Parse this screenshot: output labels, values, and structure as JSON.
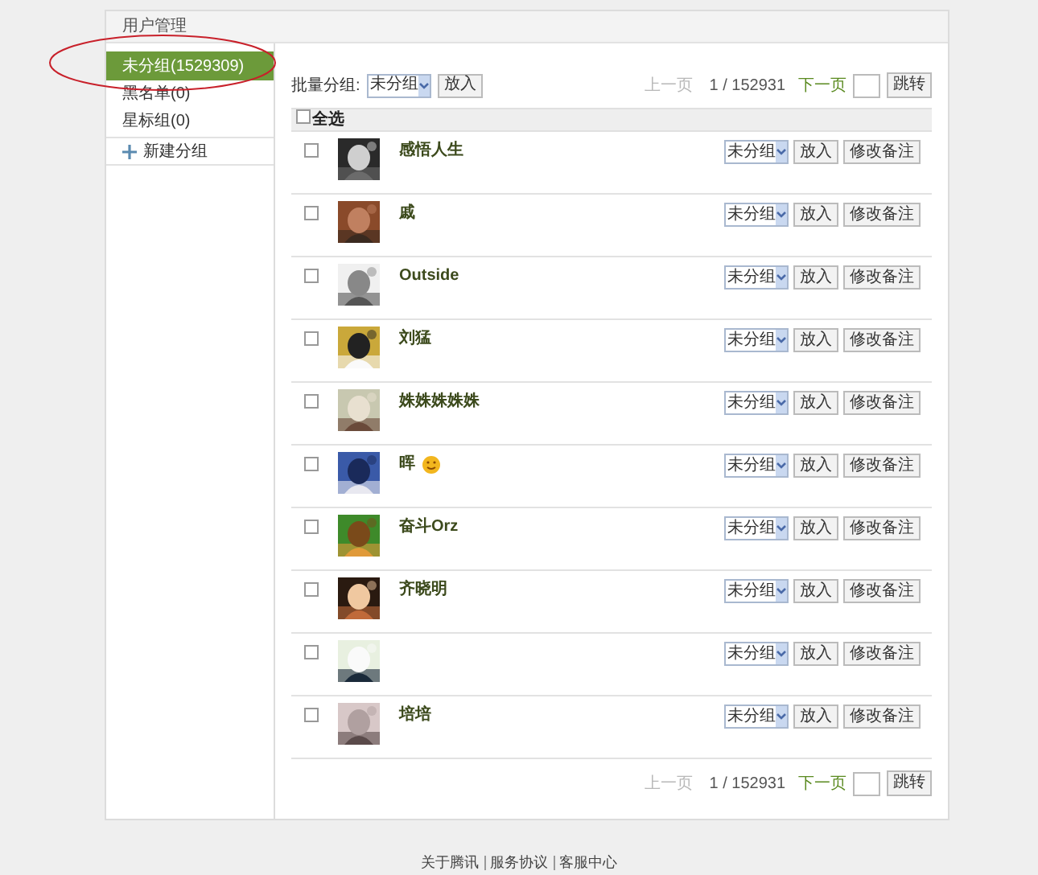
{
  "panel_title": "用户管理",
  "sidebar": {
    "items": [
      {
        "label": "未分组(1529309)",
        "selected": true
      },
      {
        "label": "黑名单(0)",
        "selected": false
      },
      {
        "label": "星标组(0)",
        "selected": false
      }
    ],
    "new_group": "新建分组"
  },
  "batch": {
    "label": "批量分组:",
    "select_value": "未分组",
    "button": "放入"
  },
  "pagers": [
    {
      "prev": "上一页",
      "prev_disabled": true,
      "page": "1 / 152931",
      "next": "下一页",
      "go": "跳转"
    },
    {
      "prev": "上一页",
      "prev_disabled": true,
      "page": "1 / 152931",
      "next": "下一页",
      "go": "跳转"
    }
  ],
  "select_all": {
    "label": "全选",
    "checked": false
  },
  "rows": [
    {
      "name": "感悟人生",
      "checked": false,
      "emoticon": false,
      "group": "未分组",
      "move": "放入",
      "remark": "修改备注"
    },
    {
      "name": "戚",
      "checked": false,
      "emoticon": false,
      "group": "未分组",
      "move": "放入",
      "remark": "修改备注"
    },
    {
      "name": "Outside",
      "checked": false,
      "emoticon": false,
      "group": "未分组",
      "move": "放入",
      "remark": "修改备注"
    },
    {
      "name": "刘猛",
      "checked": false,
      "emoticon": false,
      "group": "未分组",
      "move": "放入",
      "remark": "修改备注"
    },
    {
      "name": "姝姝姝姝姝",
      "checked": false,
      "emoticon": false,
      "group": "未分组",
      "move": "放入",
      "remark": "修改备注"
    },
    {
      "name": "晖",
      "checked": false,
      "emoticon": true,
      "group": "未分组",
      "move": "放入",
      "remark": "修改备注"
    },
    {
      "name": "奋斗Orz",
      "checked": false,
      "emoticon": false,
      "group": "未分组",
      "move": "放入",
      "remark": "修改备注"
    },
    {
      "name": "齐晓明",
      "checked": false,
      "emoticon": false,
      "group": "未分组",
      "move": "放入",
      "remark": "修改备注"
    },
    {
      "checked": false,
      "emoticon": false,
      "group": "未分组",
      "move": "放入",
      "remark": "修改备注"
    },
    {
      "name": "培培",
      "checked": false,
      "emoticon": false,
      "group": "未分组",
      "move": "放入",
      "remark": "修改备注"
    }
  ],
  "footer_links": [
    "关于腾讯",
    "服务协议",
    "客服中心"
  ]
}
